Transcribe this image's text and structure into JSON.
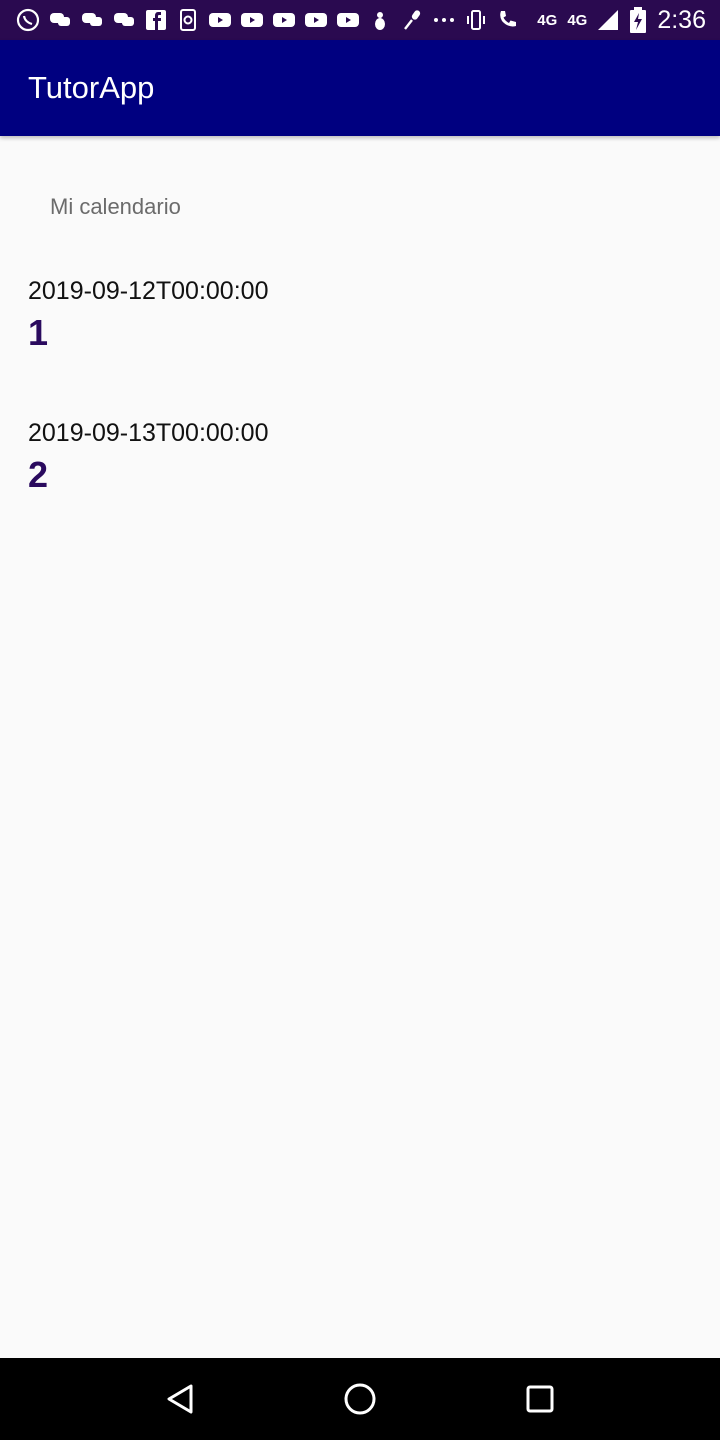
{
  "status_bar": {
    "icons": [
      "whatsapp-icon",
      "messenger-icon",
      "messenger-icon",
      "messenger-icon",
      "facebook-icon",
      "phone-chat-icon",
      "youtube-icon",
      "youtube-icon",
      "youtube-icon",
      "youtube-icon",
      "youtube-icon",
      "bug-icon",
      "mic-icon",
      "more-icon",
      "vibrate-icon",
      "wifi-call-icon"
    ],
    "network_label_small": "4G",
    "network_label": "4G",
    "time": "2:36"
  },
  "app_bar": {
    "title": "TutorApp"
  },
  "main": {
    "section_label": "Mi calendario",
    "items": [
      {
        "date": "2019-09-12T00:00:00",
        "value": "1"
      },
      {
        "date": "2019-09-13T00:00:00",
        "value": "2"
      }
    ]
  },
  "colors": {
    "status_bar_bg": "#2a0a50",
    "app_bar_bg": "#000080",
    "value_text": "#2a0a5e",
    "background": "#fafafa"
  }
}
